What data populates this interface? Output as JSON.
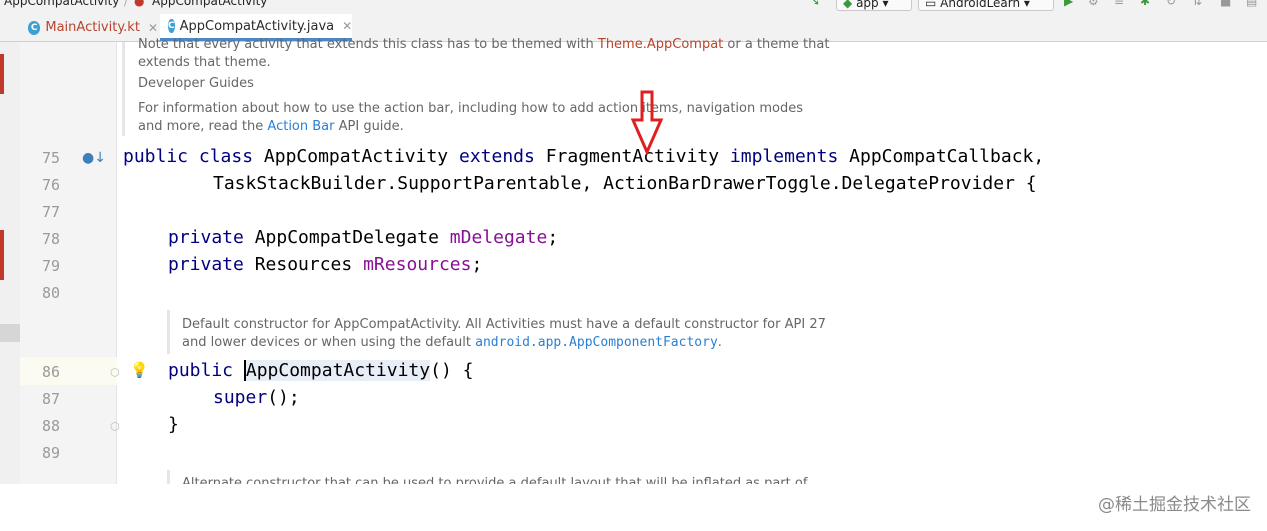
{
  "breadcrumb": {
    "item1": "AppCompatActivity",
    "item2": "AppCompatActivity"
  },
  "toolbar": {
    "config": "app",
    "device": "AndroidLearn"
  },
  "tabs": [
    {
      "label": "MainActivity.kt",
      "icon": "C"
    },
    {
      "label": "AppCompatActivity.java",
      "icon": "C"
    }
  ],
  "docs_top": {
    "line1_pre": "Note that every activity that extends this class has to be themed with ",
    "line1_ref": "Theme.AppCompat",
    "line1_post": " or a theme that",
    "line2": "extends that theme.",
    "heading": "Developer Guides",
    "line3": "For information about how to use the action bar, including how to add action items, navigation modes",
    "line4_pre": "and more, read the ",
    "line4_link": "Action Bar",
    "line4_post": " API guide."
  },
  "code": {
    "l75": {
      "num": "75",
      "kw1": "public",
      "kw2": "class",
      "name": "AppCompatActivity",
      "kw3": "extends",
      "parent": "FragmentActivity",
      "kw4": "implements",
      "iface": "AppCompatCallback,"
    },
    "l76": {
      "num": "76",
      "text": "TaskStackBuilder.SupportParentable, ActionBarDrawerToggle.DelegateProvider {"
    },
    "l77": {
      "num": "77"
    },
    "l78": {
      "num": "78",
      "kw": "private",
      "type": "AppCompatDelegate",
      "field": "mDelegate",
      "end": ";"
    },
    "l79": {
      "num": "79",
      "kw": "private",
      "type": "Resources",
      "field": "mResources",
      "end": ";"
    },
    "l80": {
      "num": "80"
    },
    "l86": {
      "num": "86",
      "kw": "public",
      "name": "AppCompatActivity",
      "rest": "() {"
    },
    "l87": {
      "num": "87",
      "kw": "super",
      "rest": "();"
    },
    "l88": {
      "num": "88",
      "text": "}"
    },
    "l89": {
      "num": "89"
    }
  },
  "docs_ctor": {
    "line1": "Default constructor for AppCompatActivity. All Activities must have a default constructor for API 27",
    "line2_pre": "and lower devices or when using the default ",
    "line2_code": "android.app.AppComponentFactory",
    "line2_post": "."
  },
  "docs_bottom": {
    "line1": "Alternate constructor that can be used to provide a default layout that will be inflated as part of"
  },
  "watermark": "@稀土掘金技术社区",
  "colors": {
    "keyword": "#000080",
    "field": "#871094",
    "arrow": "#e02020",
    "accent": "#4a88c7"
  }
}
